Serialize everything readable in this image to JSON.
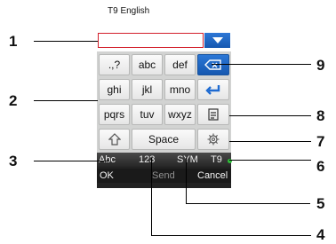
{
  "status": {
    "mode_label": "T9 English"
  },
  "input": {
    "value": ""
  },
  "keys": {
    "r1": [
      ".,?",
      "abc",
      "def"
    ],
    "r2": [
      "ghi",
      "jkl",
      "mno"
    ],
    "r3": [
      "pqrs",
      "tuv",
      "wxyz"
    ],
    "space": "Space"
  },
  "bottom_bar": {
    "abc": "Abc",
    "num": "123",
    "sym": "SYM",
    "t9": "T9"
  },
  "softkeys": {
    "ok": "OK",
    "send": "Send",
    "cancel": "Cancel"
  },
  "callouts": [
    "1",
    "2",
    "3",
    "4",
    "5",
    "6",
    "7",
    "8",
    "9"
  ],
  "colors": {
    "accent_blue": "#1f6bd1",
    "input_border": "#d21e2a",
    "indicator_green": "#2fbf3a"
  },
  "icons": {
    "dropdown": "chevron-down-icon",
    "backspace": "backspace-icon",
    "enter": "enter-icon",
    "notes": "notes-icon",
    "settings": "gear-icon",
    "shift": "shift-arrow-icon"
  }
}
